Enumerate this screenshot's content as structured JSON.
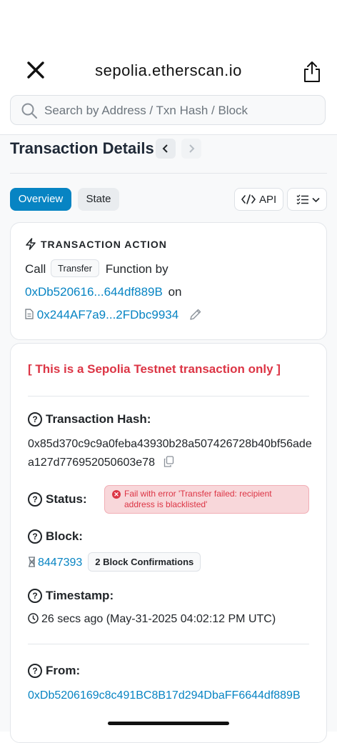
{
  "browser": {
    "url": "sepolia.etherscan.io",
    "search_placeholder": "Search by Address / Txn Hash / Block"
  },
  "page": {
    "title": "Transaction Details",
    "tabs": [
      "Overview",
      "State"
    ],
    "api_label": "API"
  },
  "action": {
    "heading": "TRANSACTION ACTION",
    "call_word": "Call",
    "method": "Transfer",
    "function_by": "Function by",
    "from_short": "0xDb520616...644df889B",
    "on_word": "on",
    "contract_short": "0x244AF7a9...2FDbc9934"
  },
  "details": {
    "testnet_notice": "[ This is a Sepolia Testnet transaction only ]",
    "hash_label": "Transaction Hash:",
    "hash_value": "0x85d370c9c9a0feba43930b28a507426728b40bf56adea127d776952050603e78",
    "status_label": "Status:",
    "status_text": "Fail with error 'Transfer failed: recipient address is blacklisted'",
    "block_label": "Block:",
    "block_number": "8447393",
    "block_confirmations": "2 Block Confirmations",
    "timestamp_label": "Timestamp:",
    "timestamp_value": "26 secs ago (May-31-2025 04:02:12 PM UTC)",
    "from_label": "From:",
    "from_value": "0xDb5206169c8c491BC8B17d294DbaFF6644df889B"
  },
  "colors": {
    "accent": "#0784c3",
    "error": "#dc3545",
    "error_bg": "#f8d7da"
  }
}
